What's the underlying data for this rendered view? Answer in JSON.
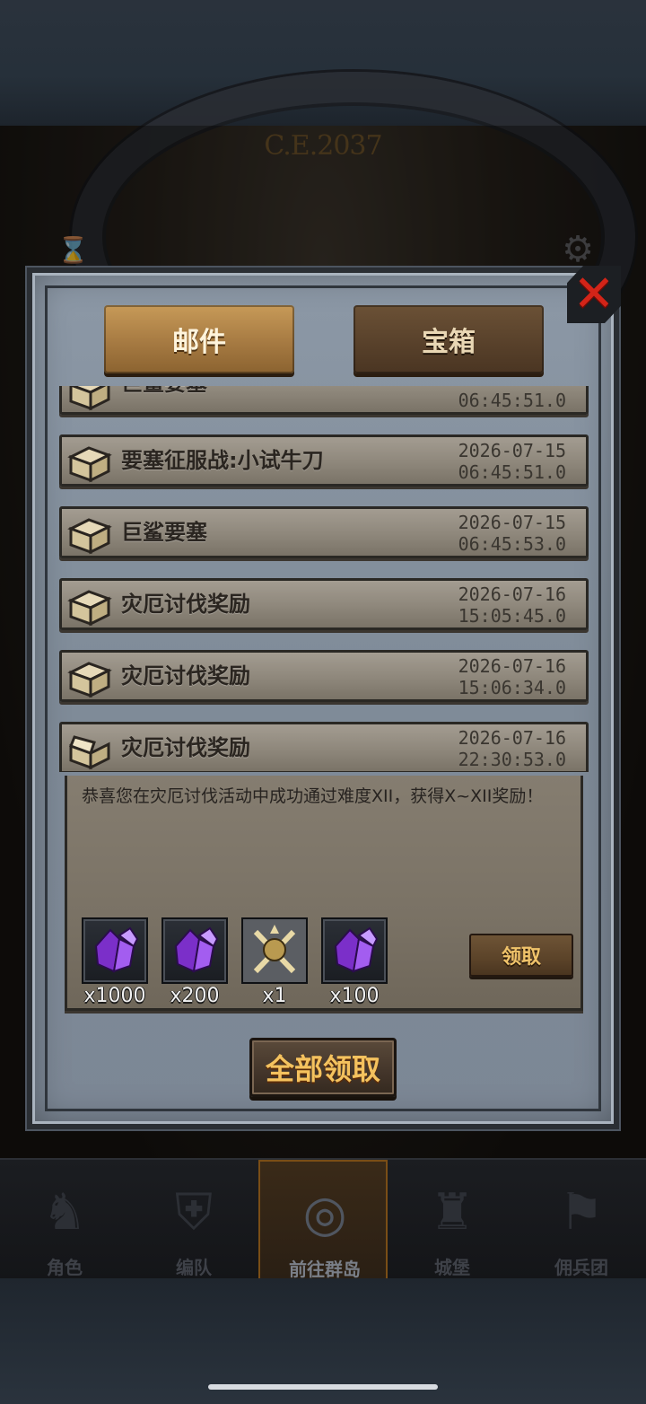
{
  "background": {
    "year": "C.E.2037",
    "icons": [
      "hourglass-icon",
      "gear-icon"
    ]
  },
  "tabs": [
    {
      "label": "邮件",
      "active": true
    },
    {
      "label": "宝箱",
      "active": false
    }
  ],
  "mails": [
    {
      "title": "巨鲨要塞",
      "date": "",
      "time": "06:45:51.0"
    },
    {
      "title": "要塞征服战:小试牛刀",
      "date": "2026-07-15",
      "time": "06:45:51.0"
    },
    {
      "title": "巨鲨要塞",
      "date": "2026-07-15",
      "time": "06:45:53.0"
    },
    {
      "title": "灾厄讨伐奖励",
      "date": "2026-07-16",
      "time": "15:05:45.0"
    },
    {
      "title": "灾厄讨伐奖励",
      "date": "2026-07-16",
      "time": "15:06:34.0"
    },
    {
      "title": "灾厄讨伐奖励",
      "date": "2026-07-16",
      "time": "22:30:53.0"
    }
  ],
  "expanded": {
    "message": "恭喜您在灾厄讨伐活动中成功通过难度XII，获得X~XII奖励！",
    "rewards": [
      {
        "icon": "purple-crystal-icon",
        "count": "x1000"
      },
      {
        "icon": "purple-crystal-icon",
        "count": "x200"
      },
      {
        "icon": "crossed-swords-emblem-icon",
        "count": "x1"
      },
      {
        "icon": "purple-crystal-icon",
        "count": "x100"
      }
    ],
    "claim_label": "领取"
  },
  "claim_all_label": "全部领取",
  "bottom_nav": [
    {
      "label": "角色",
      "glyph": "♞"
    },
    {
      "label": "编队",
      "glyph": "⛨"
    },
    {
      "label": "前往群岛",
      "glyph": "◎",
      "active": true
    },
    {
      "label": "城堡",
      "glyph": "♜"
    },
    {
      "label": "佣兵团",
      "glyph": "⚑"
    }
  ],
  "colors": {
    "accent_gold": "#f4c25e",
    "close_red": "#d32418",
    "crystal_purple": "#8a3fd6"
  }
}
